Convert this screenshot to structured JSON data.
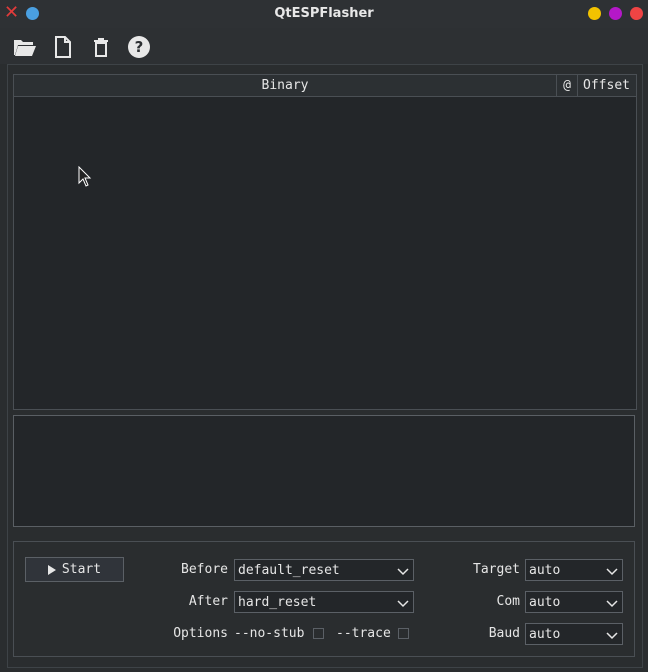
{
  "window": {
    "title": "QtESPFlasher",
    "close_color": "#e23b3b",
    "pin_color": "#4a9fe0",
    "buttons": [
      "#f2c200",
      "#b418c8",
      "#ef4444"
    ]
  },
  "toolbar": {
    "icons": [
      "open-folder-icon",
      "new-file-icon",
      "trash-icon",
      "help-icon"
    ]
  },
  "table": {
    "columns": [
      "Binary",
      "@",
      "Offset"
    ]
  },
  "controls": {
    "start_label": "Start",
    "before_label": "Before",
    "before_value": "default_reset",
    "after_label": "After",
    "after_value": "hard_reset",
    "options_label": "Options",
    "no_stub_label": "--no-stub",
    "no_stub_checked": false,
    "trace_label": "--trace",
    "trace_checked": false,
    "target_label": "Target",
    "target_value": "auto",
    "com_label": "Com",
    "com_value": "auto",
    "baud_label": "Baud",
    "baud_value": "auto"
  }
}
